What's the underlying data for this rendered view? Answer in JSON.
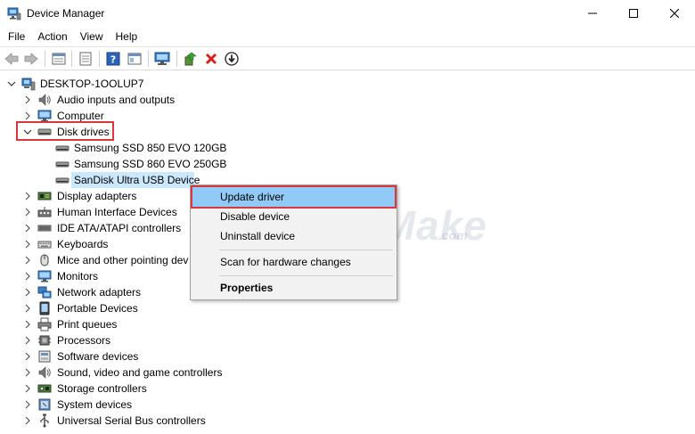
{
  "window": {
    "title": "Device Manager"
  },
  "menu": [
    "File",
    "Action",
    "View",
    "Help"
  ],
  "tree": {
    "root": "DESKTOP-1OOLUP7",
    "categories": [
      {
        "label": "Audio inputs and outputs",
        "icon": "speaker-icon"
      },
      {
        "label": "Computer",
        "icon": "monitor-icon"
      },
      {
        "label": "Disk drives",
        "icon": "disk-drive-icon",
        "expanded": true
      },
      {
        "label": "Display adapters",
        "icon": "display-adapter-icon"
      },
      {
        "label": "Human Interface Devices",
        "icon": "hid-icon"
      },
      {
        "label": "IDE ATA/ATAPI controllers",
        "icon": "ide-controller-icon"
      },
      {
        "label": "Keyboards",
        "icon": "keyboard-icon"
      },
      {
        "label": "Mice and other pointing dev",
        "icon": "mouse-icon"
      },
      {
        "label": "Monitors",
        "icon": "monitor-icon"
      },
      {
        "label": "Network adapters",
        "icon": "network-icon"
      },
      {
        "label": "Portable Devices",
        "icon": "portable-device-icon"
      },
      {
        "label": "Print queues",
        "icon": "printer-icon"
      },
      {
        "label": "Processors",
        "icon": "processor-icon"
      },
      {
        "label": "Software devices",
        "icon": "software-device-icon"
      },
      {
        "label": "Sound, video and game controllers",
        "icon": "speaker-icon"
      },
      {
        "label": "Storage controllers",
        "icon": "storage-controller-icon"
      },
      {
        "label": "System devices",
        "icon": "system-device-icon"
      },
      {
        "label": "Universal Serial Bus controllers",
        "icon": "usb-icon"
      }
    ],
    "disk_drives": [
      "Samsung SSD 850 EVO 120GB",
      "Samsung SSD 860 EVO 250GB",
      "SanDisk Ultra USB Device"
    ]
  },
  "context_menu": {
    "items": [
      "Update driver",
      "Disable device",
      "Uninstall device",
      "Scan for hardware changes",
      "Properties"
    ]
  },
  "watermark": {
    "main": "TipsMake",
    "sub": ".com"
  },
  "colors": {
    "selection": "#cce8ff",
    "menu_highlight": "#91c9f7",
    "annotation_red": "#d9363e"
  }
}
